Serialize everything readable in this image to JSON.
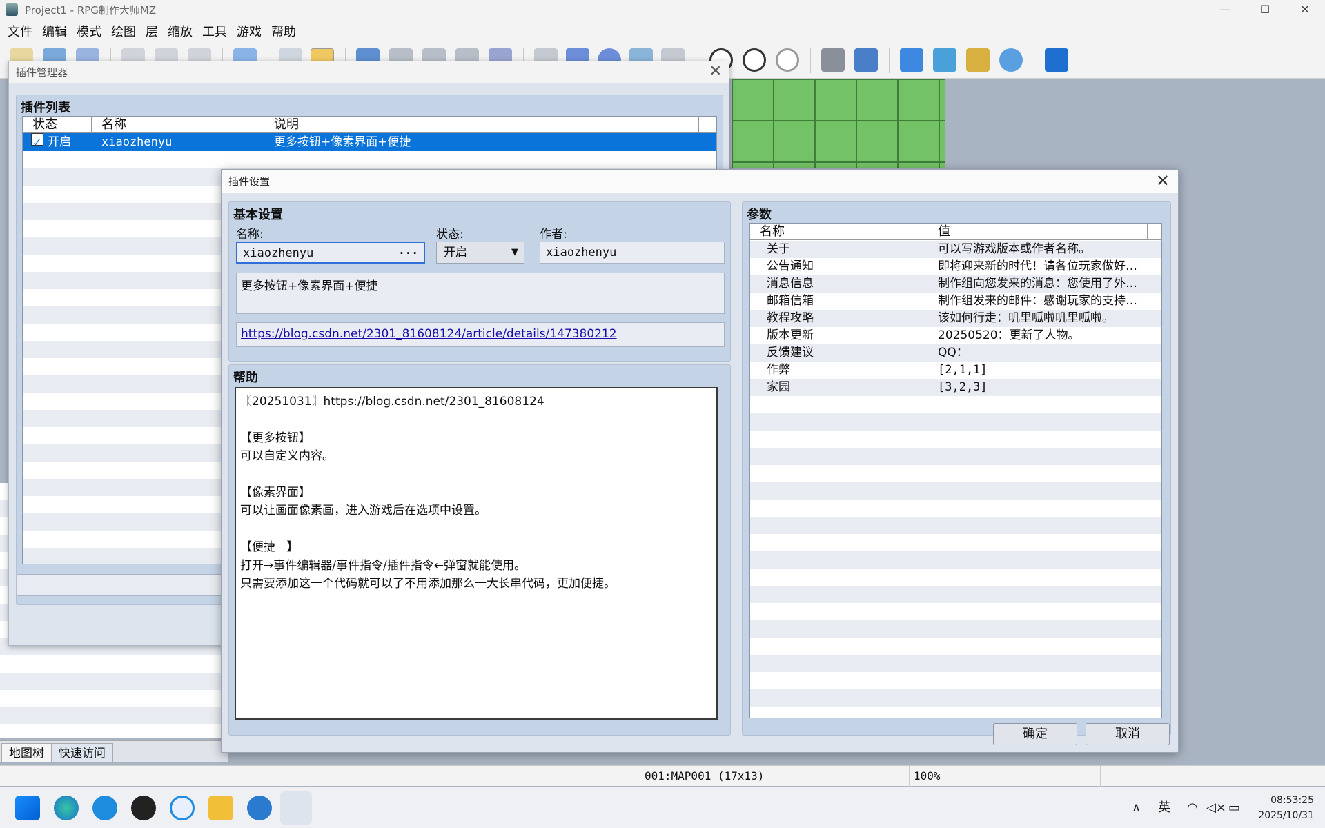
{
  "window": {
    "title": "Project1 - RPG制作大师MZ",
    "minimize": "—",
    "maximize": "☐",
    "close": "✕"
  },
  "menu": [
    "文件",
    "编辑",
    "模式",
    "绘图",
    "层",
    "缩放",
    "工具",
    "游戏",
    "帮助"
  ],
  "left_tabs": {
    "map_tree": "地图树",
    "quick_access": "快速访问"
  },
  "status_bar": {
    "map": "001:MAP001 (17x13)",
    "zoom": "100%"
  },
  "plugin_manager": {
    "title": "插件管理器",
    "group_title": "插件列表",
    "columns": [
      "状态",
      "名称",
      "说明"
    ],
    "rows": [
      {
        "checked": true,
        "status": "开启",
        "name": "xiaozhenyu",
        "description": "更多按钮+像素界面+便捷"
      }
    ]
  },
  "plugin_settings": {
    "title": "插件设置",
    "basic": {
      "group_title": "基本设置",
      "name_label": "名称:",
      "name_value": "xiaozhenyu",
      "name_button": "···",
      "status_label": "状态:",
      "status_value": "开启",
      "author_label": "作者:",
      "author_value": "xiaozhenyu",
      "description": "更多按钮+像素界面+便捷",
      "url": "https://blog.csdn.net/2301_81608124/article/details/147380212"
    },
    "help": {
      "group_title": "帮助",
      "text": "〖20251031〗https://blog.csdn.net/2301_81608124\n\n【更多按钮】\n可以自定义内容。\n\n【像素界面】\n可以让画面像素画，进入游戏后在选项中设置。\n\n【便捷   】\n打开→事件编辑器/事件指令/插件指令←弹窗就能使用。\n只需要添加这一个代码就可以了不用添加那么一大长串代码，更加便捷。"
    },
    "params": {
      "group_title": "参数",
      "columns": [
        "名称",
        "值"
      ],
      "rows": [
        {
          "name": "关于",
          "value": "可以写游戏版本或作者名称。"
        },
        {
          "name": "公告通知",
          "value": "即将迎来新的时代！请各位玩家做好…"
        },
        {
          "name": "消息信息",
          "value": "制作组向您发来的消息：您使用了外…"
        },
        {
          "name": "邮箱信箱",
          "value": "制作组发来的邮件：感谢玩家的支持…"
        },
        {
          "name": "教程攻略",
          "value": "该如何行走：叽里呱啦叽里呱啦。"
        },
        {
          "name": "版本更新",
          "value": "20250520：更新了人物。"
        },
        {
          "name": "反馈建议",
          "value": "QQ："
        },
        {
          "name": "作弊",
          "value": "[2,1,1]"
        },
        {
          "name": "家园",
          "value": "[3,2,3]"
        }
      ]
    },
    "ok_label": "确定",
    "cancel_label": "取消"
  },
  "taskbar": {
    "ime": "英",
    "time": "08:53:25",
    "date": "2025/10/31",
    "tray_up": "∧"
  },
  "colors": {
    "selection": "#0a74da",
    "group_bg": "#c4d3e6",
    "window_bg": "#dde4ee",
    "link": "#1a0dab"
  }
}
